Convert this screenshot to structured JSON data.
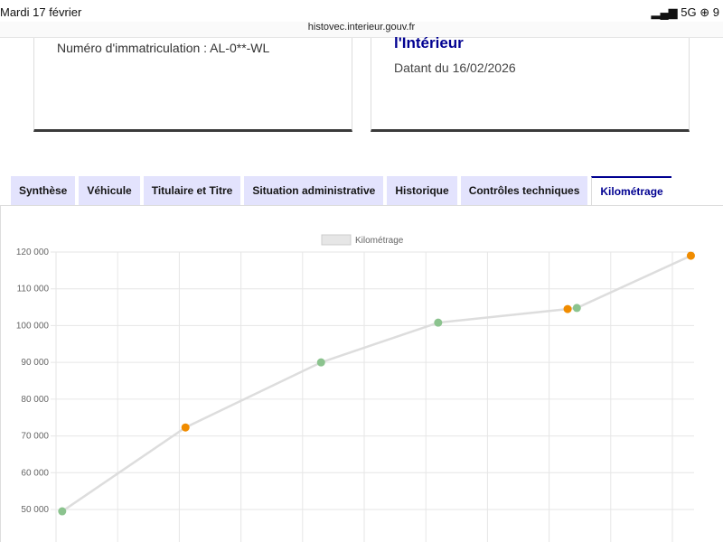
{
  "status": {
    "time": "Mardi 17 février",
    "network": "5G",
    "battery": "9"
  },
  "browser": {
    "url": "histovec.interieur.gouv.fr"
  },
  "cards": {
    "plate": "Numéro d'immatriculation : AL-0**-WL",
    "source": "l'Intérieur",
    "date": "Datant du 16/02/2026"
  },
  "tabs": [
    {
      "label": "Synthèse"
    },
    {
      "label": "Véhicule"
    },
    {
      "label": "Titulaire et Titre"
    },
    {
      "label": "Situation administrative"
    },
    {
      "label": "Historique"
    },
    {
      "label": "Contrôles techniques"
    },
    {
      "label": "Kilométrage"
    }
  ],
  "colors": {
    "line": "#dddddd",
    "green": "#8bc38e",
    "orange": "#f08c00",
    "accent": "#000091"
  },
  "chart_data": {
    "type": "line",
    "legend": "Kilométrage",
    "legend_position": "top",
    "grid": true,
    "ylim": [
      50000,
      120000
    ],
    "yticks": [
      "50 000",
      "60 000",
      "70 000",
      "80 000",
      "90 000",
      "100 000",
      "110 000",
      "120 000"
    ],
    "points": [
      {
        "x": 0.1,
        "y": 49500,
        "color": "green"
      },
      {
        "x": 2.1,
        "y": 72300,
        "color": "orange"
      },
      {
        "x": 4.3,
        "y": 90000,
        "color": "green"
      },
      {
        "x": 6.2,
        "y": 100800,
        "color": "green"
      },
      {
        "x": 8.3,
        "y": 104500,
        "color": "orange"
      },
      {
        "x": 8.45,
        "y": 104800,
        "color": "green"
      },
      {
        "x": 10.3,
        "y": 119000,
        "color": "orange"
      }
    ]
  }
}
